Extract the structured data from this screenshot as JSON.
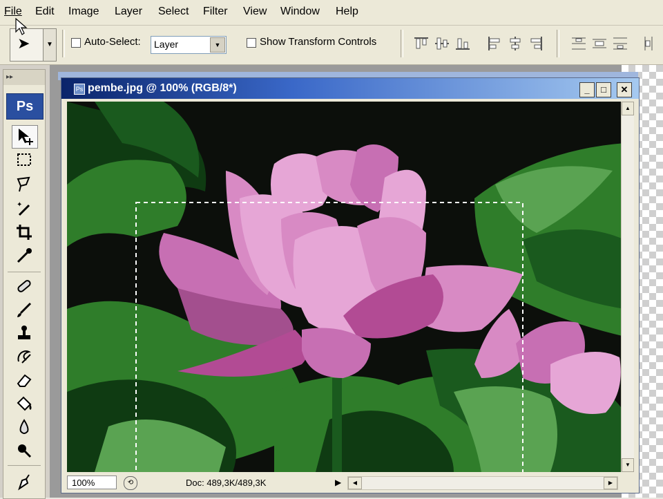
{
  "menu": [
    "File",
    "Edit",
    "Image",
    "Layer",
    "Select",
    "Filter",
    "View",
    "Window",
    "Help"
  ],
  "options": {
    "auto_select_label": "Auto-Select:",
    "auto_select_value": "Layer",
    "show_transform_label": "Show Transform Controls"
  },
  "tools": {
    "logo": "Ps",
    "items": [
      "move-tool",
      "marquee-tool",
      "lasso-tool",
      "magic-wand-tool",
      "crop-tool",
      "eyedropper-tool",
      "healing-brush-tool",
      "brush-tool",
      "clone-stamp-tool",
      "history-brush-tool",
      "eraser-tool",
      "paint-bucket-tool",
      "blur-tool",
      "dodge-tool",
      "pen-tool"
    ]
  },
  "document": {
    "title": "pembe.jpg @ 100% (RGB/8*)",
    "zoom": "100%",
    "doc_info": "Doc: 489,3K/489,3K"
  },
  "colors": {
    "title_start": "#0a246a",
    "title_end": "#a6caf0",
    "ps_blue": "#2a4fa0",
    "leaf_green": "#2f7d2a",
    "lotus_pink": "#d88ac4",
    "background_dark": "#0c0f0b"
  }
}
